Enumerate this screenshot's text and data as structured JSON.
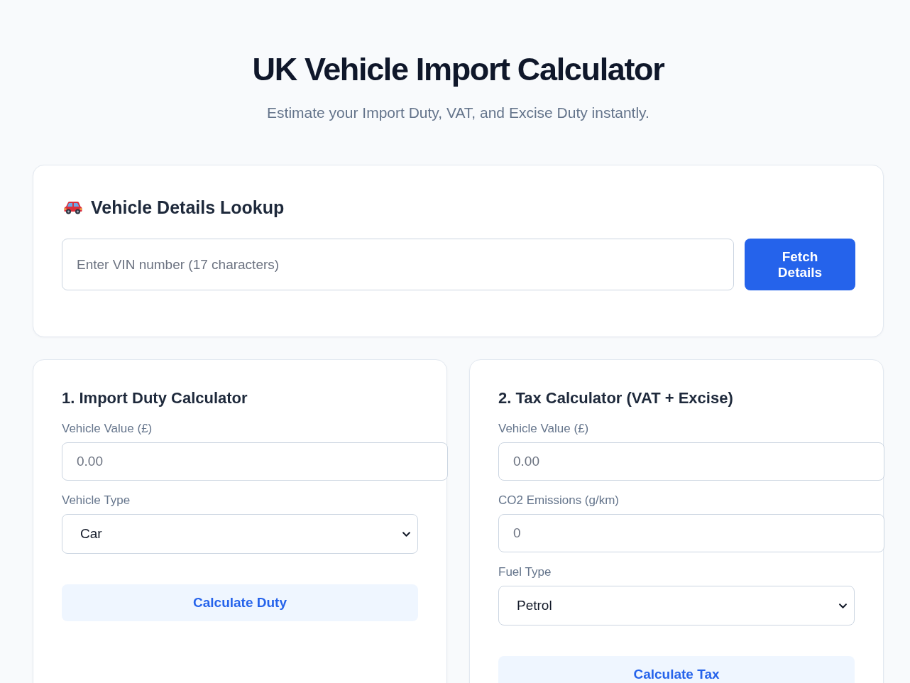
{
  "header": {
    "title": "UK Vehicle Import Calculator",
    "subtitle": "Estimate your Import Duty, VAT, and Excise Duty instantly."
  },
  "lookup": {
    "title": "Vehicle Details Lookup",
    "vin_field": {
      "placeholder": "Enter VIN number (17 characters)"
    },
    "button": "Fetch Details"
  },
  "calculators": [
    {
      "title": "1. Import Duty Calculator",
      "fields": [
        {
          "kind": "input",
          "label": "Vehicle Value (£)",
          "placeholder": "0.00"
        },
        {
          "kind": "select",
          "label": "Vehicle Type",
          "value": "Car"
        }
      ],
      "button": "Calculate Duty"
    },
    {
      "title": "2. Tax Calculator (VAT + Excise)",
      "fields": [
        {
          "kind": "input",
          "label": "Vehicle Value (£)",
          "placeholder": "0.00"
        },
        {
          "kind": "input",
          "label": "CO2 Emissions (g/km)",
          "placeholder": "0"
        },
        {
          "kind": "select",
          "label": "Fuel Type",
          "value": "Petrol"
        }
      ],
      "button": "Calculate Tax"
    }
  ]
}
